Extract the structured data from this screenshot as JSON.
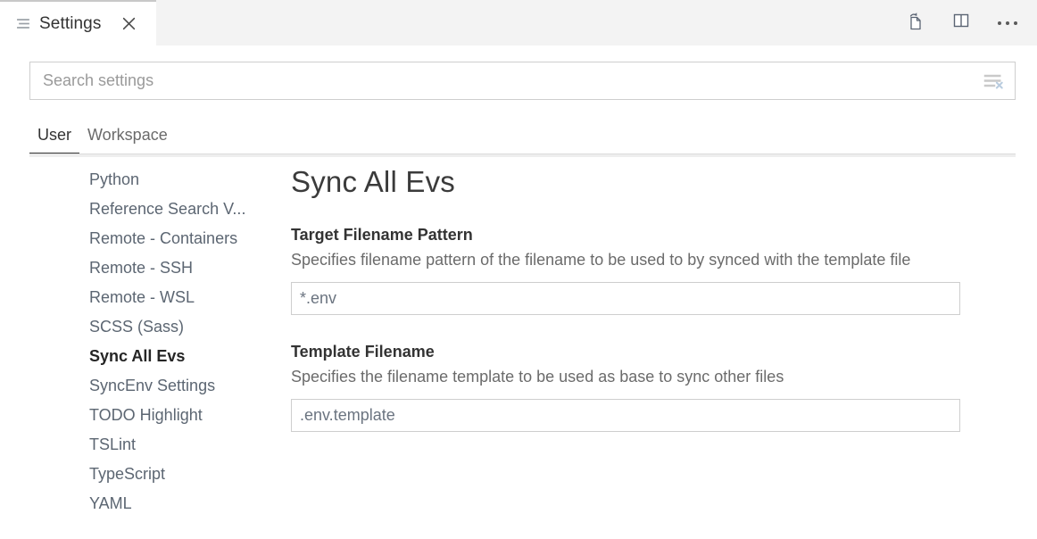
{
  "window": {
    "tab": {
      "title": "Settings",
      "icon": "settings-lines-icon",
      "close_icon": "close-icon"
    },
    "actions": [
      {
        "name": "open-settings-json-button",
        "icon": "open-json-file-icon"
      },
      {
        "name": "split-editor-button",
        "icon": "split-editor-icon"
      },
      {
        "name": "more-actions-button",
        "icon": "ellipsis-icon"
      }
    ]
  },
  "search": {
    "placeholder": "Search settings",
    "value": "",
    "clear_icon": "clear-settings-search-icon"
  },
  "scope_tabs": [
    {
      "label": "User",
      "active": true
    },
    {
      "label": "Workspace",
      "active": false
    }
  ],
  "toc": {
    "items": [
      {
        "label": "Python",
        "selected": false
      },
      {
        "label": "Reference Search V...",
        "selected": false
      },
      {
        "label": "Remote - Containers",
        "selected": false
      },
      {
        "label": "Remote - SSH",
        "selected": false
      },
      {
        "label": "Remote - WSL",
        "selected": false
      },
      {
        "label": "SCSS (Sass)",
        "selected": false
      },
      {
        "label": "Sync All Evs",
        "selected": true
      },
      {
        "label": "SyncEnv Settings",
        "selected": false
      },
      {
        "label": "TODO Highlight",
        "selected": false
      },
      {
        "label": "TSLint",
        "selected": false
      },
      {
        "label": "TypeScript",
        "selected": false
      },
      {
        "label": "YAML",
        "selected": false
      }
    ]
  },
  "pane": {
    "title": "Sync All Evs",
    "settings": [
      {
        "label": "Target Filename Pattern",
        "description": "Specifies filename pattern of the filename to be used to by synced with the template file",
        "value": "*.env"
      },
      {
        "label": "Template Filename",
        "description": "Specifies the filename template to be used as base to sync other files",
        "value": ".env.template"
      }
    ]
  },
  "colors": {
    "tabbar_bg": "#f3f3f3",
    "active_tab_bg": "#ffffff",
    "active_tab_top_border": "#c8c8c8",
    "text": "#3b3b3b",
    "muted_text": "#6b6b6b",
    "toc_text": "#5c6672",
    "input_border": "#cecece",
    "input_value_text": "#6b7480",
    "active_underline": "#3b3b3b"
  }
}
